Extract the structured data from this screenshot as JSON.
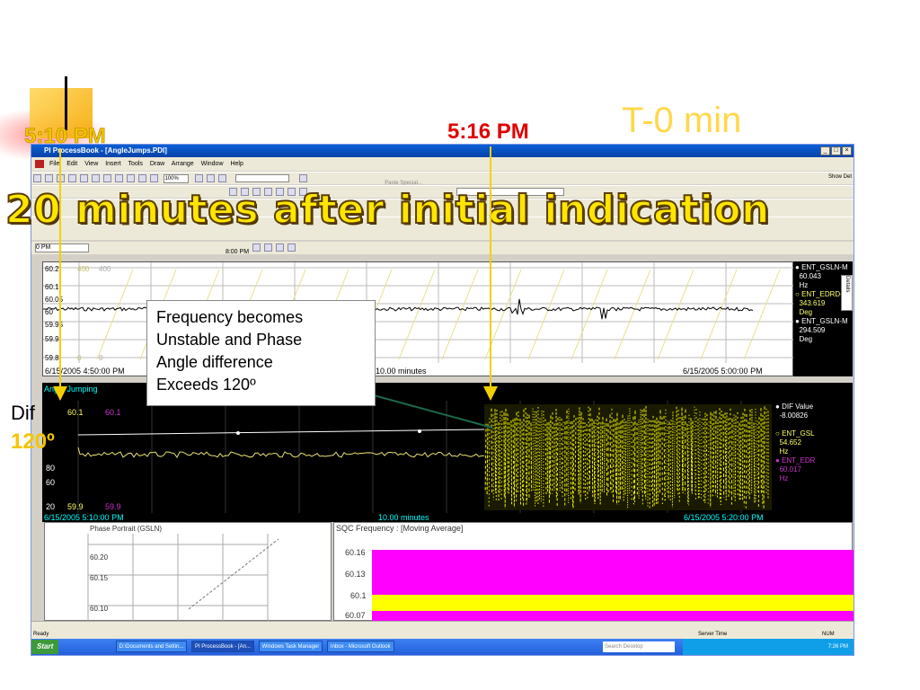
{
  "slide": {
    "headline": "20 minutes after initial indication",
    "time_label_1": "5:10 PM",
    "time_label_2": "5:16 PM",
    "t_label": "T-0 min",
    "dif_label": "Dif",
    "angle_label": "120º",
    "callout_lines": [
      "Frequency becomes",
      "Unstable and  Phase",
      "Angle difference",
      "Exceeds 120º"
    ]
  },
  "window": {
    "title": "PI ProcessBook - [AngleJumps.PDI]",
    "menu": [
      "File",
      "Edit",
      "View",
      "Insert",
      "Tools",
      "Draw",
      "Arrange",
      "Window",
      "Help"
    ],
    "zoom": "100%",
    "paste_special": "Paste Special...",
    "show_det": "Show Det",
    "time_start": "0 PM",
    "time_end": "8:00 PM"
  },
  "trend1": {
    "y_labels": [
      "60.2",
      "60.1",
      "60.05",
      "60",
      "59.95",
      "59.9",
      "59.8"
    ],
    "extra_labels": [
      "400",
      "400",
      "0",
      "0"
    ],
    "start_time": "6/15/2005 4:50:00 PM",
    "span": "10.00 minutes",
    "end_time": "6/15/2005 5:00:00 PM",
    "legend": [
      {
        "name": "ENT_GSLN-M",
        "value": "60.043",
        "unit": "Hz",
        "color": "#ffffff"
      },
      {
        "name": "ENT_EDRD-S",
        "value": "343.619",
        "unit": "Deg",
        "color": "#ffff66"
      },
      {
        "name": "ENT_GSLN-M",
        "value": "294.509",
        "unit": "Deg",
        "color": "#ffffff"
      }
    ],
    "details_tab": "Details"
  },
  "trend2": {
    "title": "Angle Jumping",
    "top_labels": [
      "60.1",
      "60.1"
    ],
    "y_left": [
      "80",
      "60",
      "20"
    ],
    "bottom_labels": [
      "59.9",
      "59.9"
    ],
    "start_time": "6/15/2005 5:10:00 PM",
    "span": "10.00 minutes",
    "end_time": "6/15/2005 5:20:00 PM",
    "legend": [
      {
        "name": "DIF Value",
        "value": "-8.00826",
        "unit": "",
        "color": "#ffffff"
      },
      {
        "name": "ENT_GSL",
        "value": "54.652",
        "unit": "Hz",
        "color": "#ffff66"
      },
      {
        "name": "ENT_EDR",
        "value": "60.017",
        "unit": "Hz",
        "color": "#cc33cc"
      }
    ]
  },
  "phase_portrait": {
    "title": "Phase Portrait (GSLN)",
    "y_labels": [
      "60.20",
      "60.15",
      "60.10"
    ]
  },
  "sqc": {
    "title": "SQC Frequency : [Moving Average]",
    "y_labels": [
      "60.16",
      "60.13",
      "60.1",
      "60.07"
    ]
  },
  "status": {
    "ready": "Ready",
    "server_time": "Server Time",
    "num": "NUM"
  },
  "taskbar": {
    "start": "Start",
    "tasks": [
      "D:\\Documents and Settin...",
      "PI ProcessBook - [An...",
      "Windows Task Manager",
      "Inbox - Microsoft Outlook"
    ],
    "search": "Search Desktop",
    "clock": "7:26 PM"
  },
  "colors": {
    "trend_yellow": "#f0f000",
    "trend_white": "#ffffff",
    "sqc_magenta": "#ff00ff",
    "sqc_yellow": "#ffff00",
    "headline": "#ffe600",
    "time_red": "#e00000"
  }
}
